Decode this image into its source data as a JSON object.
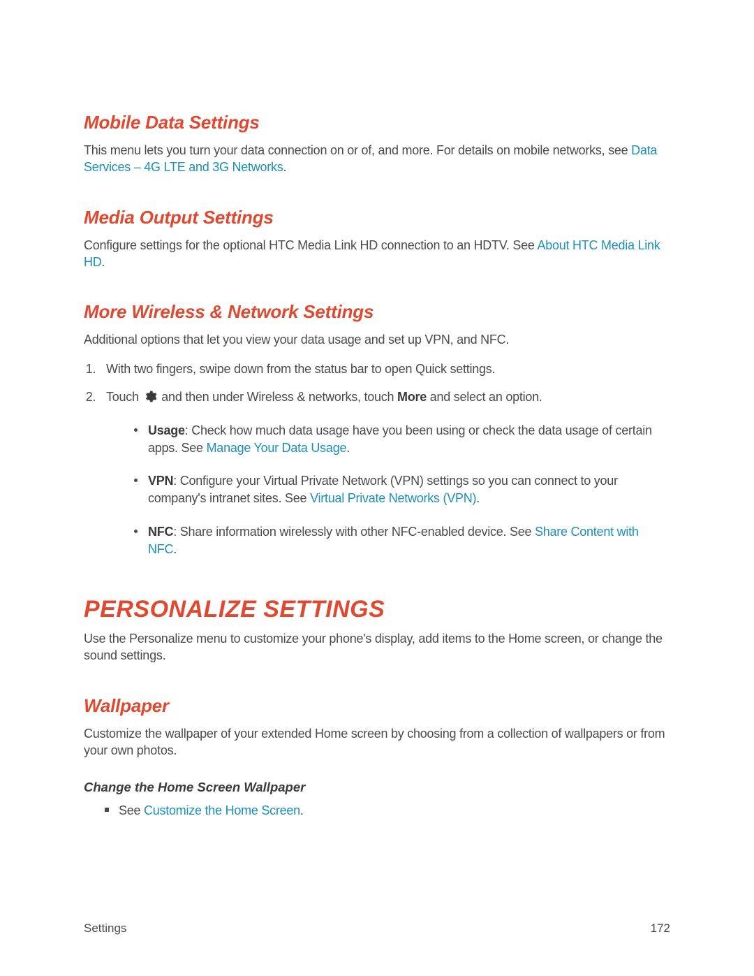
{
  "sections": {
    "mobileData": {
      "heading": "Mobile Data Settings",
      "text_before_link": "This menu lets you turn your data connection on or of, and more. For details on mobile networks, see ",
      "link": "Data Services – 4G LTE and 3G Networks",
      "text_after_link": "."
    },
    "mediaOutput": {
      "heading": "Media Output Settings",
      "text_before_link": "Configure settings for the optional HTC Media Link HD connection to an HDTV. See ",
      "link": "About HTC Media Link HD",
      "text_after_link": "."
    },
    "moreWireless": {
      "heading": "More Wireless & Network Settings",
      "intro": "Additional options that let you view your data usage and set up VPN, and NFC.",
      "step1": "With two fingers, swipe down from the status bar to open Quick settings.",
      "step2_a": "Touch ",
      "step2_b": " and then under Wireless & networks, touch ",
      "step2_bold": "More",
      "step2_c": " and select an option.",
      "bullets": {
        "usage": {
          "bold": "Usage",
          "before": ": Check how much data usage have you been using or check the data usage of certain apps. See ",
          "link": "Manage Your Data Usage",
          "after": "."
        },
        "vpn": {
          "bold": "VPN",
          "before": ": Configure your Virtual Private Network (VPN) settings so you can connect to your company's intranet sites. See ",
          "link": "Virtual Private Networks (VPN)",
          "after": "."
        },
        "nfc": {
          "bold": "NFC",
          "before": ": Share information wirelessly with other NFC-enabled device. See ",
          "link": "Share Content with NFC",
          "after": "."
        }
      }
    },
    "personalize": {
      "heading": "PERSONALIZE SETTINGS",
      "text": "Use the Personalize menu to customize your phone's display, add items to the Home screen, or change the sound settings."
    },
    "wallpaper": {
      "heading": "Wallpaper",
      "text": "Customize the wallpaper of your extended Home screen by choosing from a collection of wallpapers or from your own photos.",
      "sub": "Change the Home Screen Wallpaper",
      "bullet_before": "See ",
      "bullet_link": "Customize the Home Screen",
      "bullet_after": "."
    }
  },
  "footer": {
    "left": "Settings",
    "right": "172"
  }
}
